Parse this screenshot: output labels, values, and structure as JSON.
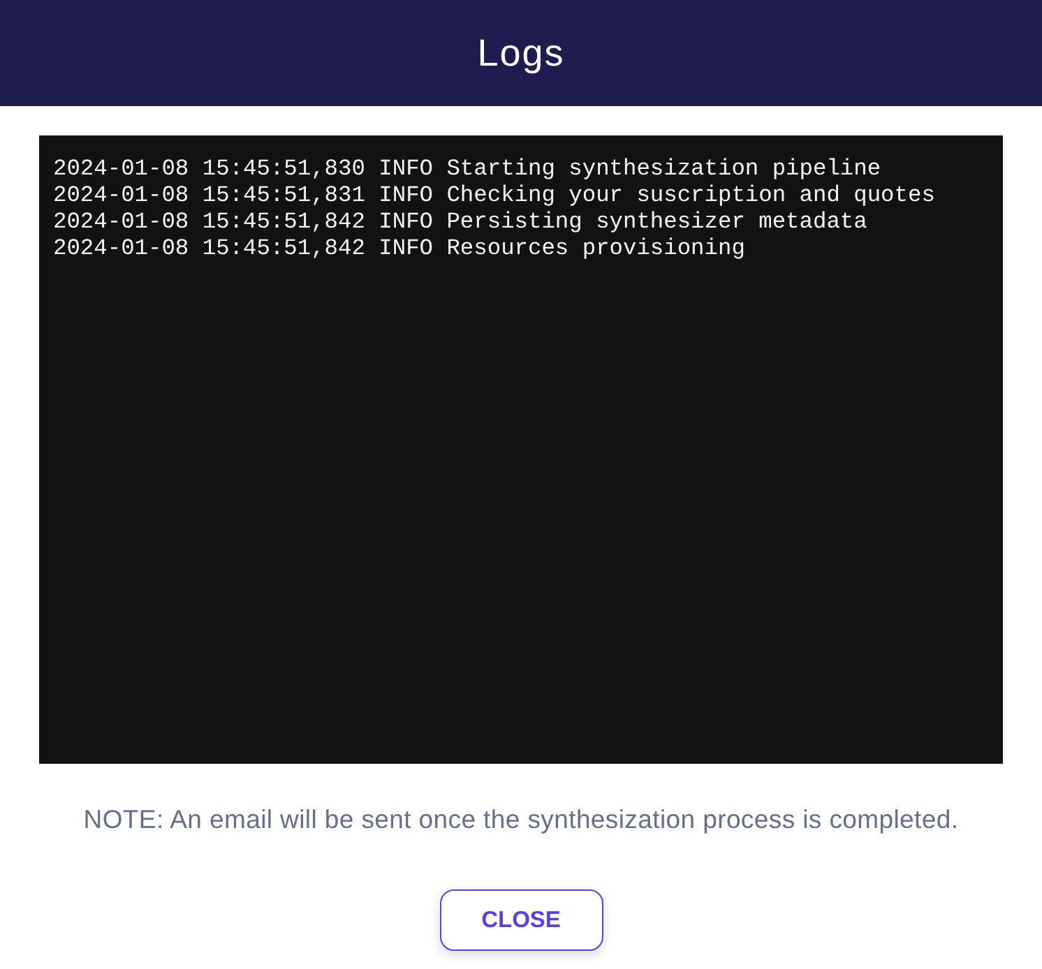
{
  "dialog": {
    "title": "Logs"
  },
  "log_lines": [
    "2024-01-08 15:45:51,830 INFO Starting synthesization pipeline",
    "2024-01-08 15:45:51,831 INFO Checking your suscription and quotes",
    "2024-01-08 15:45:51,842 INFO Persisting synthesizer metadata",
    "2024-01-08 15:45:51,842 INFO Resources provisioning"
  ],
  "note": "NOTE: An email will be sent once the synthesization process is completed.",
  "buttons": [
    {
      "label": "CLOSE"
    }
  ]
}
